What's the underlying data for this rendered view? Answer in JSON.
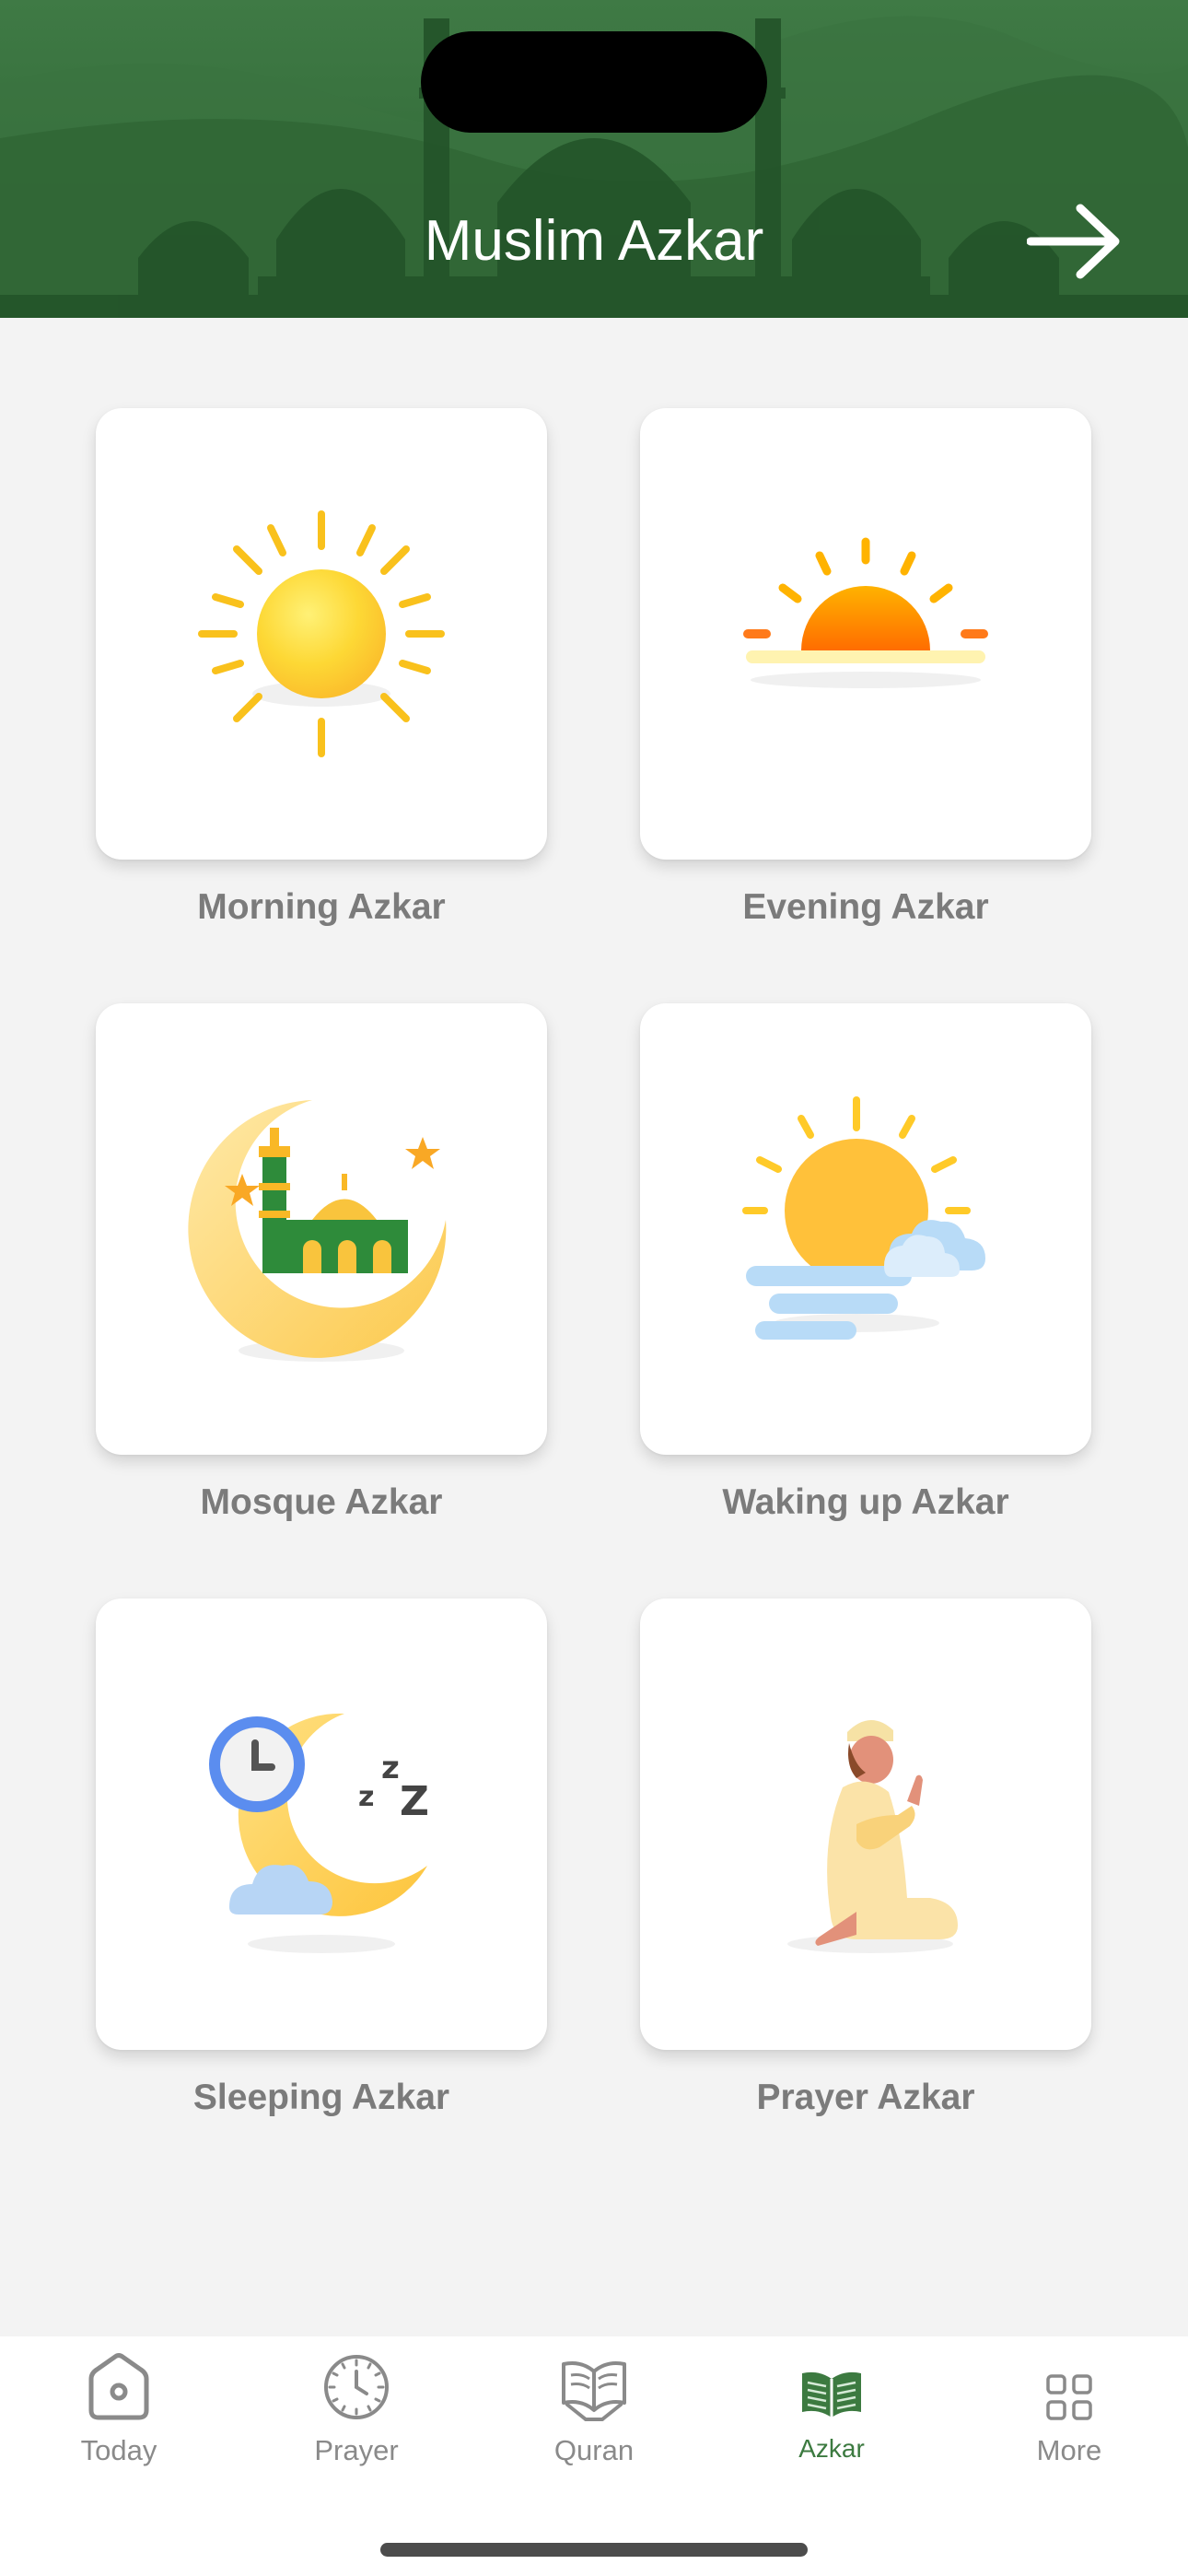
{
  "header": {
    "title": "Muslim Azkar"
  },
  "categories": [
    {
      "label": "Morning Azkar",
      "icon": "sun-icon"
    },
    {
      "label": "Evening Azkar",
      "icon": "sunset-icon"
    },
    {
      "label": "Mosque Azkar",
      "icon": "crescent-mosque-icon"
    },
    {
      "label": "Waking up Azkar",
      "icon": "sun-cloud-icon"
    },
    {
      "label": "Sleeping Azkar",
      "icon": "moon-clock-sleep-icon"
    },
    {
      "label": "Prayer Azkar",
      "icon": "praying-man-icon"
    }
  ],
  "tabbar": {
    "tabs": [
      {
        "label": "Today",
        "icon": "home-icon",
        "active": false
      },
      {
        "label": "Prayer",
        "icon": "clock-icon",
        "active": false
      },
      {
        "label": "Quran",
        "icon": "open-book-icon",
        "active": false
      },
      {
        "label": "Azkar",
        "icon": "azkar-book-icon",
        "active": true
      },
      {
        "label": "More",
        "icon": "grid-icon",
        "active": false
      }
    ]
  },
  "colors": {
    "header_green": "#356e3b",
    "active_tab": "#3c7a40",
    "label_gray": "#7b7b7b",
    "background": "#f3f3f3"
  }
}
